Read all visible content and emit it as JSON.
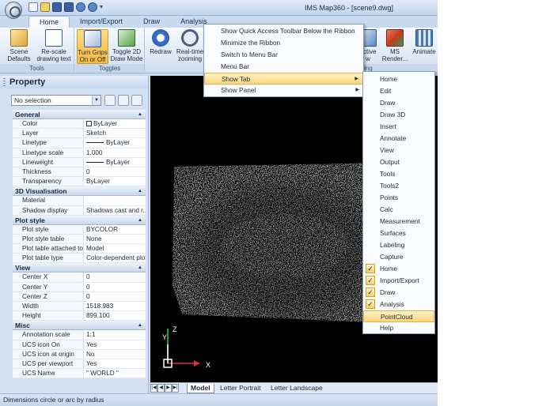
{
  "window": {
    "title": "IMS Map360 - [scene9.dwg]"
  },
  "qat_icons": [
    "new-icon",
    "open-icon",
    "save-icon",
    "saveas-icon",
    "undo-icon",
    "redo-icon",
    "dropdown-icon"
  ],
  "tabs": [
    "Home",
    "Import/Export",
    "Draw",
    "Analysis"
  ],
  "ribbon": {
    "tools_label": "Tools",
    "toggles_label": "Toggles",
    "rendering_label": "ndering",
    "buttons": {
      "scene_defaults": "Scene Defaults",
      "rescale": "Re-scale drawing text",
      "grips": "Turn Grips On or Off",
      "toggle2d": "Toggle 2D Draw Mode",
      "redraw": "Redraw",
      "realtime": "Real-time zooming",
      "perspective": "ective w",
      "ms_render": "MS Render...",
      "animate": "Animate"
    }
  },
  "context_menu": {
    "items": [
      "Show Quick Access Toolbar Below the Ribbon",
      "Minimize the Ribbon",
      "Switch to Menu Bar",
      "Menu Bar",
      "Show Tab",
      "Show Panel"
    ],
    "highlighted": "Show Tab"
  },
  "show_tab_menu": {
    "items": [
      {
        "label": "Home",
        "checked": false
      },
      {
        "label": "Edit",
        "checked": false
      },
      {
        "label": "Draw",
        "checked": false
      },
      {
        "label": "Draw 3D",
        "checked": false
      },
      {
        "label": "Insert",
        "checked": false
      },
      {
        "label": "Annotate",
        "checked": false
      },
      {
        "label": "View",
        "checked": false
      },
      {
        "label": "Output",
        "checked": false
      },
      {
        "label": "Tools",
        "checked": false
      },
      {
        "label": "Tools2",
        "checked": false
      },
      {
        "label": "Points",
        "checked": false
      },
      {
        "label": "Calc",
        "checked": false
      },
      {
        "label": "Measurement",
        "checked": false
      },
      {
        "label": "Surfaces",
        "checked": false
      },
      {
        "label": "Labeling",
        "checked": false
      },
      {
        "label": "Capture",
        "checked": false
      },
      {
        "label": "Home",
        "checked": true
      },
      {
        "label": "Import/Export",
        "checked": true
      },
      {
        "label": "Draw",
        "checked": true
      },
      {
        "label": "Analysis",
        "checked": true
      },
      {
        "label": "PointCloud",
        "checked": false,
        "highlighted": true
      },
      {
        "label": "Help",
        "checked": false
      }
    ]
  },
  "property_panel": {
    "title": "Property",
    "selection": "No selection",
    "categories": [
      {
        "name": "General",
        "rows": [
          {
            "k": "Color",
            "v": "ByLayer",
            "swatch": true
          },
          {
            "k": "Layer",
            "v": "Sketch"
          },
          {
            "k": "Linetype",
            "v": "ByLayer",
            "line": true
          },
          {
            "k": "Linetype scale",
            "v": "1.000"
          },
          {
            "k": "Lineweight",
            "v": "ByLayer",
            "line": true
          },
          {
            "k": "Thickness",
            "v": "0"
          },
          {
            "k": "Transparency",
            "v": "ByLayer"
          }
        ]
      },
      {
        "name": "3D Visualisation",
        "rows": [
          {
            "k": "Material",
            "v": ""
          },
          {
            "k": "Shadow display",
            "v": "Shadows cast and r..."
          }
        ]
      },
      {
        "name": "Plot style",
        "rows": [
          {
            "k": "Plot style",
            "v": "BYCOLOR"
          },
          {
            "k": "Plot style table",
            "v": "None"
          },
          {
            "k": "Plot table attached to",
            "v": "Model"
          },
          {
            "k": "Plot table type",
            "v": "Color-dependent plot..."
          }
        ]
      },
      {
        "name": "View",
        "rows": [
          {
            "k": "Center X",
            "v": "0"
          },
          {
            "k": "Center Y",
            "v": "0"
          },
          {
            "k": "Center Z",
            "v": "0"
          },
          {
            "k": "Width",
            "v": "1518.983"
          },
          {
            "k": "Height",
            "v": "899.100"
          }
        ]
      },
      {
        "name": "Misc",
        "rows": [
          {
            "k": "Annotation scale",
            "v": "1:1"
          },
          {
            "k": "UCS icon On",
            "v": "Yes"
          },
          {
            "k": "UCS icon at origin",
            "v": "No"
          },
          {
            "k": "UCS per viewport",
            "v": "Yes"
          },
          {
            "k": "UCS Name",
            "v": "\" WORLD \""
          }
        ]
      }
    ]
  },
  "viewport": {
    "ucs": {
      "x": "X",
      "y": "Y",
      "z": "Z"
    },
    "layout_tabs": [
      "Model",
      "Letter Portrait",
      "Letter Landscape"
    ],
    "active_layout": "Model"
  },
  "status_bar": {
    "text": "Dimensions circle or arc by radius"
  }
}
